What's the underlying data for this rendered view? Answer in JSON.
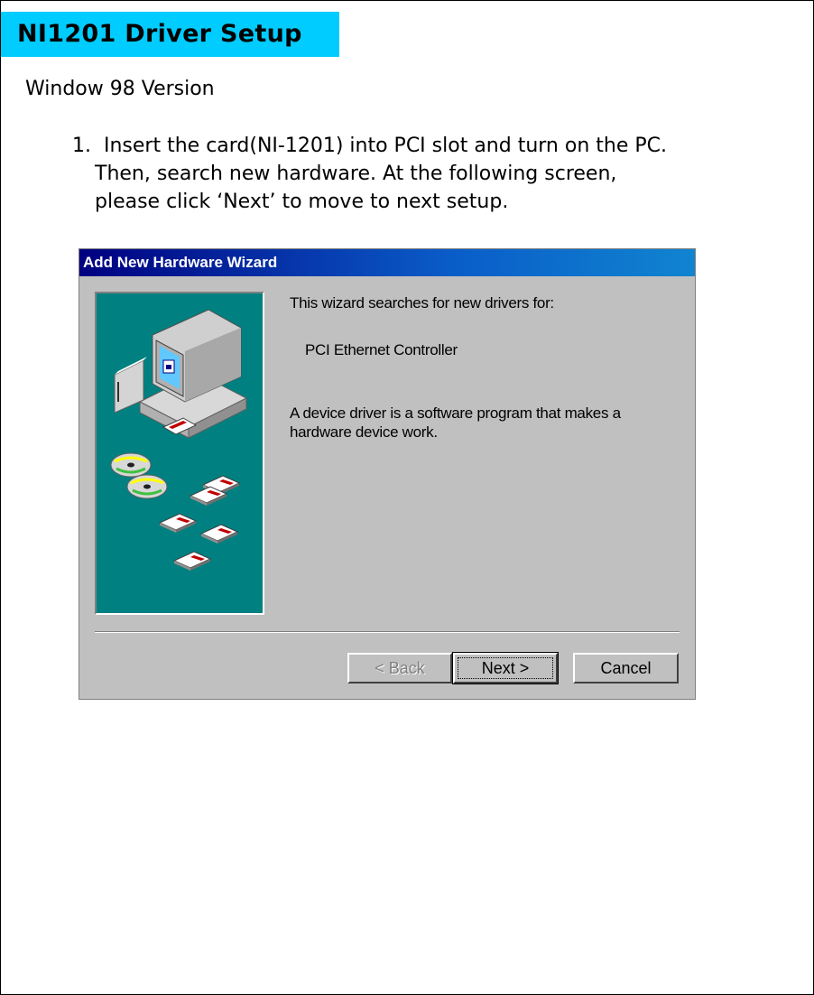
{
  "page": {
    "title": "NI1201 Driver Setup",
    "subtitle": "Window 98 Version",
    "step": {
      "number": "1.",
      "line1": "Insert the card(NI-1201) into PCI slot and turn on the PC.",
      "line2": "Then, search new hardware. At the following screen,",
      "line3": "please click ‘Next’ to move to next setup."
    }
  },
  "dialog": {
    "title": "Add New Hardware Wizard",
    "intro": "This wizard searches for new drivers for:",
    "device": "PCI Ethernet Controller",
    "desc_line1": "A device driver is a software program that makes a",
    "desc_line2": "hardware device work.",
    "buttons": {
      "back": "< Back",
      "next": "Next >",
      "cancel": "Cancel"
    }
  },
  "colors": {
    "title_bar_bg": "#00ccff",
    "dialog_title_gradient_start": "#000080",
    "dialog_title_gradient_end": "#1084d0",
    "illustration_bg": "#008080",
    "dialog_bg": "#c0c0c0"
  },
  "icons": [
    "computer-icon",
    "cd-icon",
    "floppy-disk-icon"
  ]
}
